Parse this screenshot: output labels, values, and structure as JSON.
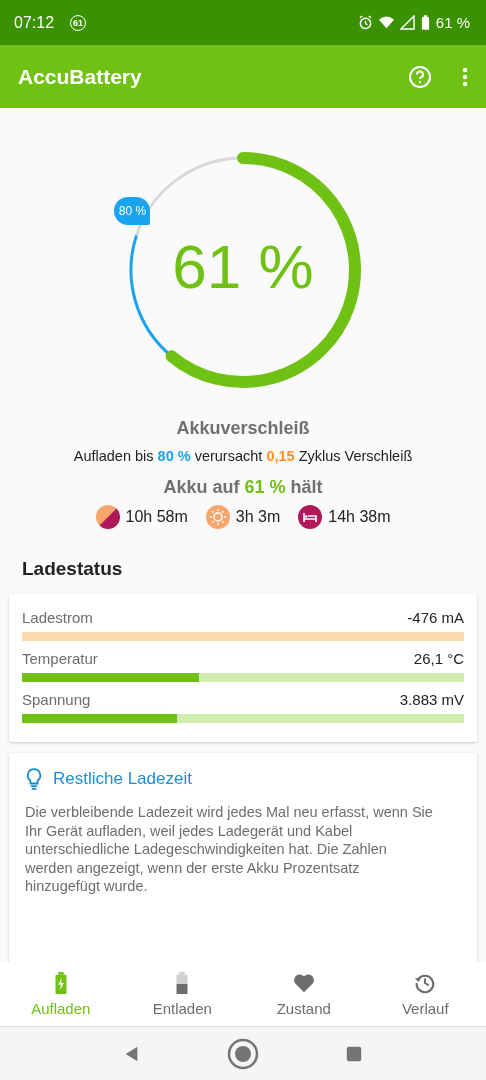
{
  "status_bar": {
    "time": "07:12",
    "badge": "61",
    "battery": "61 %"
  },
  "app_bar": {
    "title": "AccuBattery"
  },
  "gauge": {
    "reading": "61 %",
    "marker": {
      "label": "80 %"
    }
  },
  "wear": {
    "title": "Akkuverschleiß",
    "sentence": [
      {
        "kind": "plain",
        "text": "Aufladen bis "
      },
      {
        "kind": "target",
        "text": "80 %"
      },
      {
        "kind": "plain",
        "text": " verursacht "
      },
      {
        "kind": "wear",
        "text": "0,15"
      },
      {
        "kind": "plain",
        "text": " Zyklus Verschleiß"
      }
    ],
    "holds": [
      {
        "kind": "plain",
        "text": "Akku auf "
      },
      {
        "kind": "charge",
        "text": "61 %"
      },
      {
        "kind": "plain",
        "text": " hält"
      }
    ],
    "estimates": [
      {
        "kind": "mixed",
        "text": "10h 58m"
      },
      {
        "kind": "screen_on",
        "text": "3h 3m"
      },
      {
        "kind": "sleep",
        "text": "14h 38m"
      }
    ]
  },
  "charge_status": {
    "title": "Ladestatus",
    "rows": [
      {
        "label": "Ladestrom",
        "value": "-476 mA",
        "color": "#fdd9b0"
      },
      {
        "label": "Temperatur",
        "value": "26,1 °C",
        "level": 0.4,
        "color": "#6fc213"
      },
      {
        "label": "Spannung",
        "value": "3.883 mV",
        "level": 0.35,
        "color": "#6fc213"
      }
    ]
  },
  "info_card": {
    "title": "Restliche Ladezeit",
    "text": "Die verbleibende Ladezeit wird jedes Mal neu erfasst, wenn Sie Ihr Gerät aufladen, weil jedes Ladegerät und Kabel unterschiedliche Ladegeschwindigkeiten hat. Die Zahlen werden angezeigt, wenn der erste Akku Prozentsatz hinzugefügt wurde."
  },
  "bottom_nav": [
    {
      "kind": "charge",
      "label": "Aufladen",
      "selected": true
    },
    {
      "kind": "discharge",
      "label": "Entladen",
      "selected": false
    },
    {
      "kind": "health",
      "label": "Zustand",
      "selected": false
    },
    {
      "kind": "history",
      "label": "Verlauf",
      "selected": false
    }
  ]
}
